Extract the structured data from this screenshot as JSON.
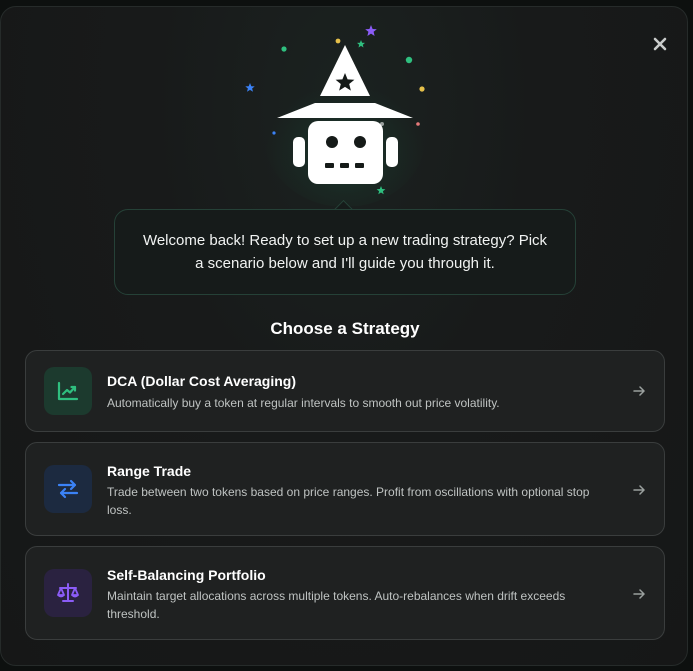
{
  "modal": {
    "welcome_message": "Welcome back! Ready to set up a new trading strategy? Pick a scenario below and I'll guide you through it.",
    "section_title": "Choose a Strategy",
    "close_icon": "close-icon",
    "mascot_icon": "wizard-robot-icon"
  },
  "strategies": [
    {
      "title": "DCA (Dollar Cost Averaging)",
      "description": "Automatically buy a token at regular intervals to smooth out price volatility.",
      "icon": "chart-up-icon",
      "accent": "#2fbf7f"
    },
    {
      "title": "Range Trade",
      "description": "Trade between two tokens based on price ranges. Profit from oscillations with optional stop loss.",
      "icon": "swap-arrows-icon",
      "accent": "#3b82f6"
    },
    {
      "title": "Self-Balancing Portfolio",
      "description": "Maintain target allocations across multiple tokens. Auto-rebalances when drift exceeds threshold.",
      "icon": "scale-icon",
      "accent": "#8b5cf6"
    }
  ],
  "colors": {
    "brand_green": "#2fbf7f",
    "background": "#161717",
    "card_background": "#1f2121"
  }
}
